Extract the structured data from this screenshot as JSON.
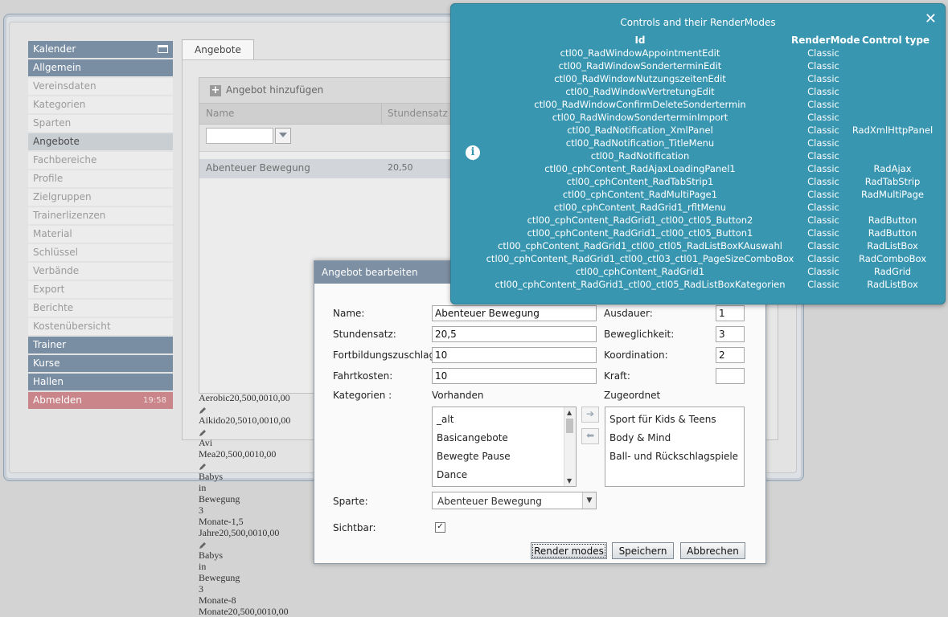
{
  "sidebar": {
    "items": [
      {
        "label": "Kalender",
        "style": "dark",
        "time": ""
      },
      {
        "label": "Allgemein",
        "style": "dark",
        "time": ""
      },
      {
        "label": "Vereinsdaten",
        "style": "light",
        "time": ""
      },
      {
        "label": "Kategorien",
        "style": "light",
        "time": ""
      },
      {
        "label": "Sparten",
        "style": "light",
        "time": ""
      },
      {
        "label": "Angebote",
        "style": "active",
        "time": ""
      },
      {
        "label": "Fachbereiche",
        "style": "light",
        "time": ""
      },
      {
        "label": "Profile",
        "style": "light",
        "time": ""
      },
      {
        "label": "Zielgruppen",
        "style": "light",
        "time": ""
      },
      {
        "label": "Trainerlizenzen",
        "style": "light",
        "time": ""
      },
      {
        "label": "Material",
        "style": "light",
        "time": ""
      },
      {
        "label": "Schlüssel",
        "style": "light",
        "time": ""
      },
      {
        "label": "Verbände",
        "style": "light",
        "time": ""
      },
      {
        "label": "Export",
        "style": "light",
        "time": ""
      },
      {
        "label": "Berichte",
        "style": "light",
        "time": ""
      },
      {
        "label": "Kostenübersicht",
        "style": "light",
        "time": ""
      },
      {
        "label": "Trainer",
        "style": "dark",
        "time": ""
      },
      {
        "label": "Kurse",
        "style": "dark",
        "time": ""
      },
      {
        "label": "Hallen",
        "style": "dark",
        "time": ""
      },
      {
        "label": "Abmelden",
        "style": "logout",
        "time": "19:58"
      }
    ]
  },
  "tabs": [
    {
      "label": "Angebote"
    }
  ],
  "grid": {
    "add_label": "Angebot hinzufügen",
    "columns": [
      "Name",
      "Stundensatz"
    ],
    "filter_value": "",
    "rows": [
      {
        "name": "Abenteuer Bewegung",
        "rate": "20,50"
      }
    ]
  },
  "overflow_entries": [
    "Aerobic20,500,0010,00",
    "Aikido20,5010,0010,00",
    "Avi\nMea20,500,0010,00",
    "Babys\nin\nBewegung\n3\nMonate-1,5\nJahre20,500,0010,00",
    "Babys\nin\nBewegung\n3\nMonate-8\nMonate20,500,0010,00"
  ],
  "dialog": {
    "title": "Angebot bearbeiten",
    "labels": {
      "name": "Name:",
      "rate": "Stundensatz:",
      "training": "Fortbildungszuschlag:",
      "travel": "Fahrtkosten:",
      "categories": "Kategorien :",
      "available": "Vorhanden",
      "assigned": "Zugeordnet",
      "endurance": "Ausdauer:",
      "mobility": "Beweglichkeit:",
      "coordination": "Koordination:",
      "strength": "Kraft:",
      "division": "Sparte:",
      "visible": "Sichtbar:"
    },
    "values": {
      "name": "Abenteuer Bewegung",
      "rate": "20,5",
      "training": "10",
      "travel": "10",
      "endurance": "1",
      "mobility": "3",
      "coordination": "2",
      "strength": "",
      "division": "Abenteuer Bewegung",
      "visible_checked": "✓"
    },
    "available_items": [
      "_alt",
      "Basicangebote",
      "Bewegte Pause",
      "Dance"
    ],
    "assigned_items": [
      "Sport für Kids & Teens",
      "Body & Mind",
      "Ball- und Rückschlagspiele"
    ],
    "buttons": {
      "render": "Render modes",
      "save": "Speichern",
      "cancel": "Abbrechen"
    }
  },
  "notification": {
    "title": "Controls and their RenderModes",
    "headers": {
      "id": "Id",
      "mode": "RenderMode",
      "type": "Control type"
    },
    "rows": [
      {
        "id": "ctl00_RadWindowAppointmentEdit",
        "mode": "Classic",
        "type": ""
      },
      {
        "id": "ctl00_RadWindowSonderterminEdit",
        "mode": "Classic",
        "type": ""
      },
      {
        "id": "ctl00_RadWindowNutzungszeitenEdit",
        "mode": "Classic",
        "type": ""
      },
      {
        "id": "ctl00_RadWindowVertretungEdit",
        "mode": "Classic",
        "type": ""
      },
      {
        "id": "ctl00_RadWindowConfirmDeleteSondertermin",
        "mode": "Classic",
        "type": ""
      },
      {
        "id": "ctl00_RadWindowSonderterminImport",
        "mode": "Classic",
        "type": ""
      },
      {
        "id": "ctl00_RadNotification_XmlPanel",
        "mode": "Classic",
        "type": "RadXmlHttpPanel"
      },
      {
        "id": "ctl00_RadNotification_TitleMenu",
        "mode": "Classic",
        "type": ""
      },
      {
        "id": "ctl00_RadNotification",
        "mode": "Classic",
        "type": ""
      },
      {
        "id": "ctl00_cphContent_RadAjaxLoadingPanel1",
        "mode": "Classic",
        "type": "RadAjax"
      },
      {
        "id": "ctl00_cphContent_RadTabStrip1",
        "mode": "Classic",
        "type": "RadTabStrip"
      },
      {
        "id": "ctl00_cphContent_RadMultiPage1",
        "mode": "Classic",
        "type": "RadMultiPage"
      },
      {
        "id": "ctl00_cphContent_RadGrid1_rfltMenu",
        "mode": "Classic",
        "type": ""
      },
      {
        "id": "ctl00_cphContent_RadGrid1_ctl00_ctl05_Button2",
        "mode": "Classic",
        "type": "RadButton"
      },
      {
        "id": "ctl00_cphContent_RadGrid1_ctl00_ctl05_Button1",
        "mode": "Classic",
        "type": "RadButton"
      },
      {
        "id": "ctl00_cphContent_RadGrid1_ctl00_ctl05_RadListBoxKAuswahl",
        "mode": "Classic",
        "type": "RadListBox"
      },
      {
        "id": "ctl00_cphContent_RadGrid1_ctl00_ctl03_ctl01_PageSizeComboBox",
        "mode": "Classic",
        "type": "RadComboBox"
      },
      {
        "id": "ctl00_cphContent_RadGrid1",
        "mode": "Classic",
        "type": "RadGrid"
      },
      {
        "id": "ctl00_cphContent_RadGrid1_ctl00_ctl05_RadListBoxKategorien",
        "mode": "Classic",
        "type": "RadListBox"
      }
    ]
  }
}
